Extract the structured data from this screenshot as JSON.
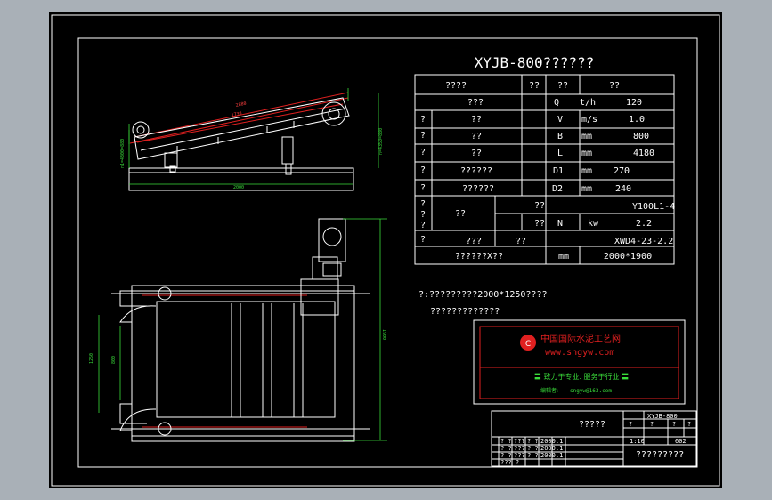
{
  "drawing": {
    "title": "XYJB-800??????",
    "spec_table": {
      "header": [
        "????",
        "??",
        "??",
        "??"
      ],
      "rows": [
        {
          "c1": "",
          "c2": "???",
          "c3": "Q",
          "c4": "t/h",
          "c5": "120"
        },
        {
          "c1": "?",
          "c2": "??",
          "c3": "V",
          "c4": "m/s",
          "c5": "1.0"
        },
        {
          "c1": "?",
          "c2": "??",
          "c3": "B",
          "c4": "mm",
          "c5": "800"
        },
        {
          "c1": "?",
          "c2": "??",
          "c3": "L",
          "c4": "mm",
          "c5": "4180"
        },
        {
          "c1": "?",
          "c2": "??????",
          "c3": "D1",
          "c4": "mm",
          "c5": "270"
        },
        {
          "c1": "?",
          "c2": "??????",
          "c3": "D2",
          "c4": "mm",
          "c5": "240"
        }
      ],
      "motor_group": {
        "left": [
          "?",
          "?",
          "?"
        ],
        "left2": "?",
        "name": "??",
        "r1_c3": "??",
        "r1_val": "Y100L1-4",
        "r2_c3": "??",
        "r2_sym": "N",
        "r2_unit": "kw",
        "r2_val": "2.2",
        "r3_name": "???",
        "r3_c3": "??",
        "r3_val": "XWD4-23-2.2"
      },
      "last_row": {
        "c2": "??????X??",
        "c4": "mm",
        "c5": "2000*1900"
      }
    },
    "note_line1": "?:?????????2000*1250????",
    "note_line2": "?????????????",
    "logo_box": {
      "name_cn": "中国国际水泥工艺网",
      "url": "www.sngyw.com",
      "slogan": "〓 致力于专业. 服务于行业 〓",
      "contact_label": "编辑者:",
      "contact": "sngyw@163.com"
    },
    "title_block": {
      "drawing_name": "?????",
      "code": "XYJB-800",
      "scale": "1:10",
      "sheet_no": "602",
      "company": "?????????",
      "small_cells": [
        "? ?",
        "???",
        "? ?",
        "2000.1",
        "? ?",
        "???",
        "? ?",
        "2000.1",
        "? ?",
        "???",
        "? ?",
        "2000.1",
        "??? ?"
      ],
      "top_cells": [
        "?",
        "?",
        "?",
        "?"
      ]
    },
    "dimensions": {
      "side_top1": "2880",
      "side_top2": "1730",
      "side_base": "2000",
      "side_left": "n1=4300=880",
      "side_right": "n=4350=880",
      "plan_height": "1900",
      "plan_left1": "1250",
      "plan_left2": "800"
    },
    "colors": {
      "background": "#000000",
      "frame": "#ffffff",
      "dimension": "#3adc3a",
      "accent": "#e02020"
    }
  }
}
